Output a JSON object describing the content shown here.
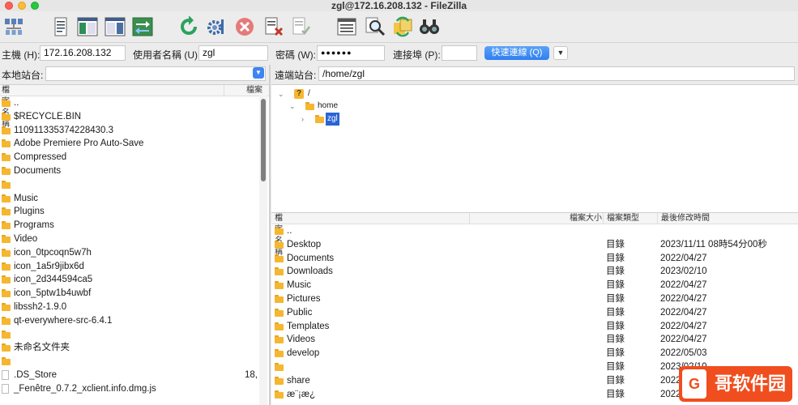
{
  "window": {
    "title": "zgl@172.16.208.132 - FileZilla"
  },
  "toolbar": {
    "icons": [
      "site-manager-icon",
      "message-log-icon",
      "local-tree-icon",
      "remote-tree-icon",
      "transfer-queue-icon",
      "refresh-icon",
      "process-queue-icon",
      "cancel-icon",
      "disconnect-icon",
      "reconnect-icon",
      "directory-listing-filters-icon",
      "search-icon",
      "synchronized-browsing-icon",
      "directory-comparison-icon"
    ]
  },
  "quickconnect": {
    "host_label": "主機 (H):",
    "host_value": "172.16.208.132",
    "user_label": "使用者名稱 (U):",
    "user_value": "zgl",
    "pass_label": "密碼 (W):",
    "pass_value": "●●●●●●",
    "port_label": "連接埠 (P):",
    "port_value": "",
    "connect_label": "快速連線 (Q)",
    "dropdown_label": "▼"
  },
  "local": {
    "site_label": "本地站台:",
    "site_value": "",
    "header_name": "檔案名稱",
    "header_size": "檔案",
    "files": [
      {
        "name": "..",
        "size": "",
        "kind": "folder"
      },
      {
        "name": "$RECYCLE.BIN",
        "size": "",
        "kind": "folder"
      },
      {
        "name": "110911335374228430.3",
        "size": "",
        "kind": "folder"
      },
      {
        "name": "Adobe Premiere Pro Auto-Save",
        "size": "",
        "kind": "folder"
      },
      {
        "name": "Compressed",
        "size": "",
        "kind": "folder"
      },
      {
        "name": "Documents",
        "size": "",
        "kind": "folder"
      },
      {
        "name": "",
        "size": "",
        "kind": "folder"
      },
      {
        "name": "Music",
        "size": "",
        "kind": "folder"
      },
      {
        "name": "Plugins",
        "size": "",
        "kind": "folder"
      },
      {
        "name": "Programs",
        "size": "",
        "kind": "folder"
      },
      {
        "name": "Video",
        "size": "",
        "kind": "folder"
      },
      {
        "name": "icon_0tpcoqn5w7h",
        "size": "",
        "kind": "folder"
      },
      {
        "name": "icon_1a5r9jibx6d",
        "size": "",
        "kind": "folder"
      },
      {
        "name": "icon_2d344594ca5",
        "size": "",
        "kind": "folder"
      },
      {
        "name": "icon_5ptw1b4uwbf",
        "size": "",
        "kind": "folder"
      },
      {
        "name": "libssh2-1.9.0",
        "size": "",
        "kind": "folder"
      },
      {
        "name": "qt-everywhere-src-6.4.1",
        "size": "",
        "kind": "folder"
      },
      {
        "name": "",
        "size": "",
        "kind": "folder"
      },
      {
        "name": "未命名文件夹",
        "size": "",
        "kind": "folder"
      },
      {
        "name": "",
        "size": "",
        "kind": "folder"
      },
      {
        "name": ".DS_Store",
        "size": "18,",
        "kind": "file"
      },
      {
        "name": "_Fenêtre_0.7.2_xclient.info.dmg.js",
        "size": "",
        "kind": "file"
      }
    ]
  },
  "remote": {
    "site_label": "遠端站台:",
    "site_value": "/home/zgl",
    "tree": [
      {
        "label": "/",
        "level": 0,
        "chevron": "⌄",
        "icon": "?"
      },
      {
        "label": "home",
        "level": 1,
        "chevron": "⌄",
        "icon": "folder"
      },
      {
        "label": "zgl",
        "level": 2,
        "chevron": "›",
        "icon": "folder",
        "selected": true
      }
    ],
    "header_name": "檔案名稱",
    "header_size": "檔案大小",
    "header_type": "檔案類型",
    "header_modified": "最後修改時間",
    "files": [
      {
        "name": "..",
        "type": "",
        "modified": ""
      },
      {
        "name": "Desktop",
        "type": "目錄",
        "modified": "2023/11/11 08時54分00秒"
      },
      {
        "name": "Documents",
        "type": "目錄",
        "modified": "2022/04/27"
      },
      {
        "name": "Downloads",
        "type": "目錄",
        "modified": "2023/02/10"
      },
      {
        "name": "Music",
        "type": "目錄",
        "modified": "2022/04/27"
      },
      {
        "name": "Pictures",
        "type": "目錄",
        "modified": "2022/04/27"
      },
      {
        "name": "Public",
        "type": "目錄",
        "modified": "2022/04/27"
      },
      {
        "name": "Templates",
        "type": "目錄",
        "modified": "2022/04/27"
      },
      {
        "name": "Videos",
        "type": "目錄",
        "modified": "2022/04/27"
      },
      {
        "name": "develop",
        "type": "目錄",
        "modified": "2022/05/03"
      },
      {
        "name": "",
        "type": "目錄",
        "modified": "2023/02/10"
      },
      {
        "name": "share",
        "type": "目錄",
        "modified": "2022/05/0"
      },
      {
        "name": "æ¨¡æ¿",
        "type": "目錄",
        "modified": "2022/04/27"
      }
    ]
  },
  "watermark": {
    "text": "哥软件园",
    "badge": "G"
  }
}
